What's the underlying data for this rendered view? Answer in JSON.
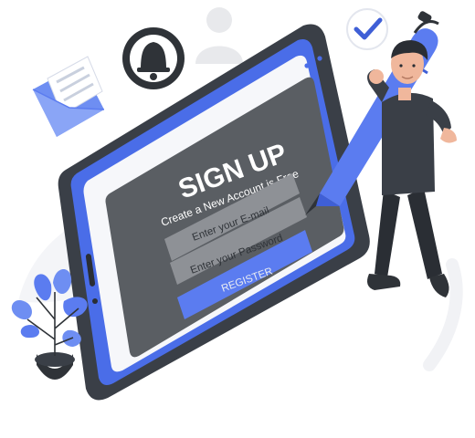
{
  "form": {
    "title": "SIGN UP",
    "subtitle": "Create a New Account is Free",
    "email_placeholder": "Enter your E-mail",
    "password_placeholder": "Enter your Password",
    "register_label": "REGISTER"
  },
  "icons": [
    "envelope-icon",
    "bell-icon",
    "user-icon",
    "checkmark-icon",
    "pen-icon",
    "plant-icon"
  ],
  "colors": {
    "accent": "#5b7cf0",
    "accent_dark": "#3f5fd6",
    "tablet_frame": "#3a3f47",
    "form_panel": "#5a5e63",
    "field": "#8e9196",
    "text_light": "#e9ecf2"
  }
}
